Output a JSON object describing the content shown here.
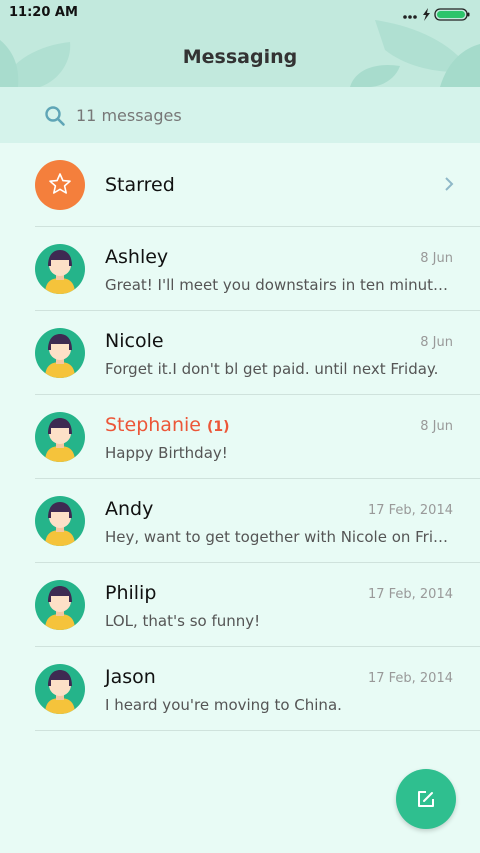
{
  "status_bar": {
    "time": "11:20 AM",
    "icons": [
      "more-dots-icon",
      "charging-bolt-icon",
      "battery-icon"
    ]
  },
  "header": {
    "title": "Messaging"
  },
  "search": {
    "placeholder": "11 messages",
    "icon": "search-icon"
  },
  "starred": {
    "label": "Starred",
    "icon": "star-icon",
    "chevron_icon": "chevron-right-icon"
  },
  "conversations": [
    {
      "name": "Ashley",
      "badge": "",
      "date": "8 Jun",
      "preview": "Great! I'll meet you downstairs in ten minutes....",
      "unread": false
    },
    {
      "name": "Nicole",
      "badge": "",
      "date": "8 Jun",
      "preview": "Forget it.I don't bl get paid. until next Friday.",
      "unread": false
    },
    {
      "name": "Stephanie",
      "badge": "(1)",
      "date": "8 Jun",
      "preview": "Happy Birthday!",
      "unread": true
    },
    {
      "name": "Andy",
      "badge": "",
      "date": "17 Feb, 2014",
      "preview": "Hey, want to get together with Nicole on Friday?",
      "unread": false
    },
    {
      "name": "Philip",
      "badge": "",
      "date": "17 Feb, 2014",
      "preview": "LOL, that's so funny!",
      "unread": false
    },
    {
      "name": "Jason",
      "badge": "",
      "date": "17 Feb, 2014",
      "preview": "I heard you're moving to China.",
      "unread": false
    }
  ],
  "fab": {
    "icon": "compose-icon"
  },
  "colors": {
    "header_bg": "#c2e9dd",
    "background": "#e8fbf5",
    "accent_green": "#2fbf8f",
    "starred_orange": "#f47f3c",
    "unread_red": "#ec5638"
  }
}
